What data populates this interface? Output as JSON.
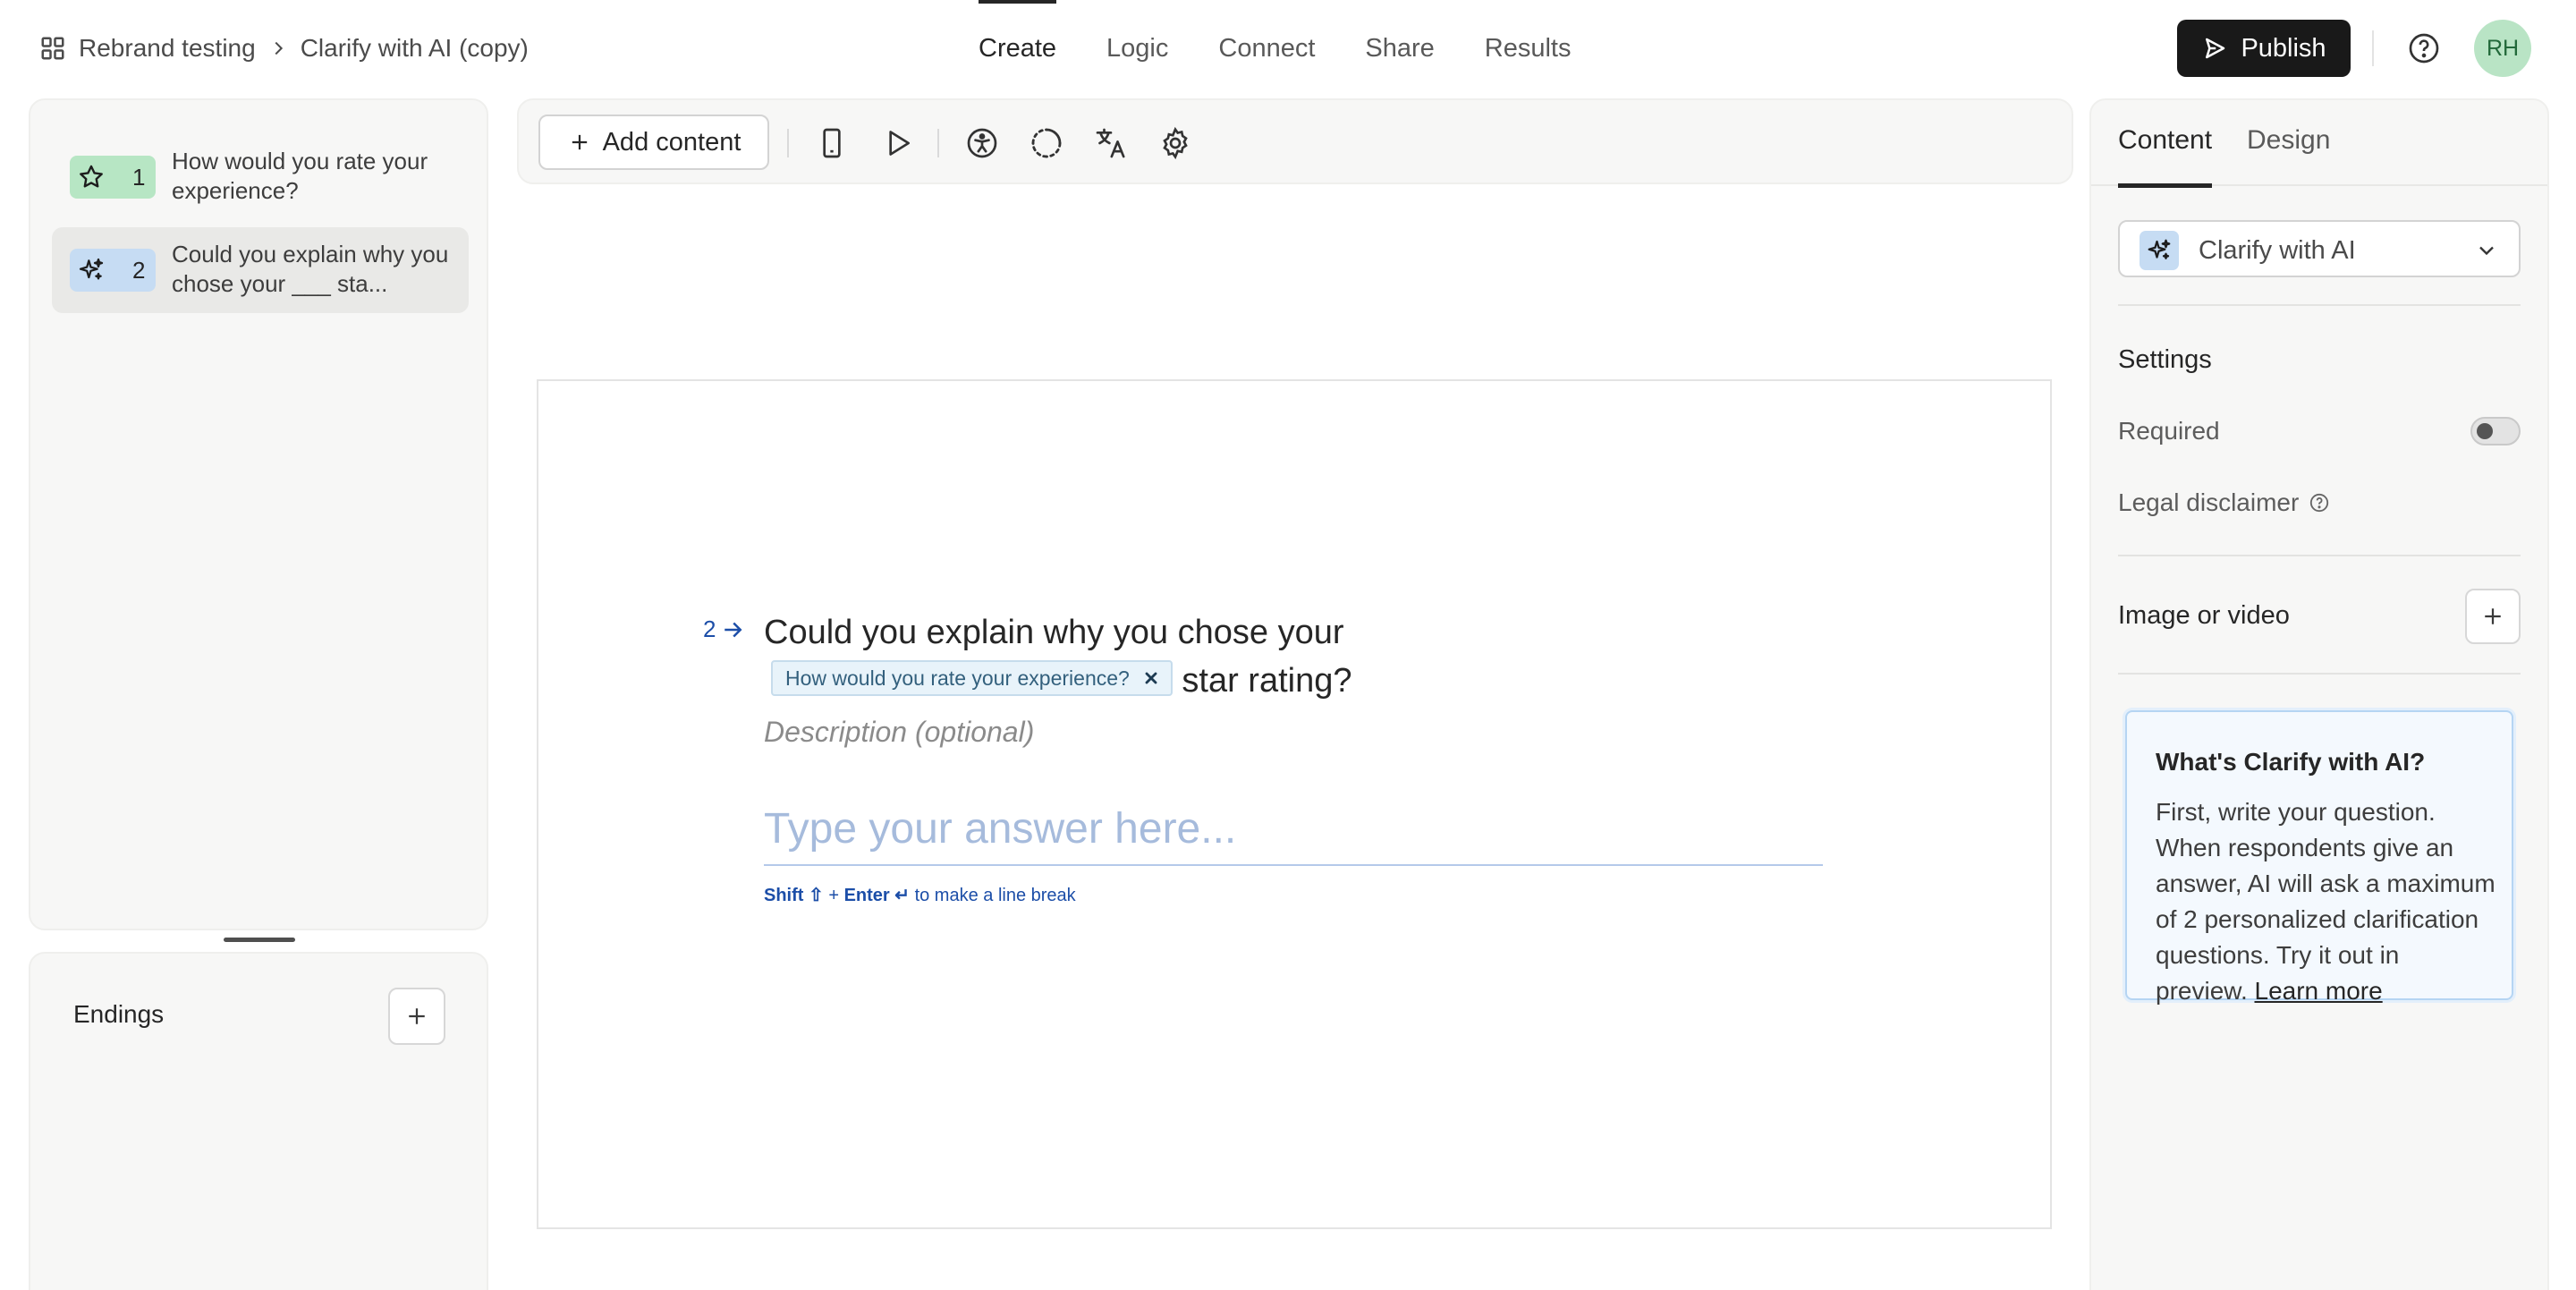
{
  "header": {
    "breadcrumb_workspace": "Rebrand testing",
    "breadcrumb_form": "Clarify with AI (copy)",
    "nav_tabs": [
      {
        "label": "Create",
        "active": true
      },
      {
        "label": "Logic",
        "active": false
      },
      {
        "label": "Connect",
        "active": false
      },
      {
        "label": "Share",
        "active": false
      },
      {
        "label": "Results",
        "active": false
      }
    ],
    "publish_label": "Publish",
    "avatar_initials": "RH"
  },
  "questions": [
    {
      "number": "1",
      "label": "How would you rate your experience?",
      "icon": "star-icon",
      "color": "#b7e6c4",
      "selected": false
    },
    {
      "number": "2",
      "label": "Could you explain why you chose your ___ sta...",
      "icon": "sparkle-icon",
      "color": "#c6dcf3",
      "selected": true
    }
  ],
  "endings": {
    "title": "Endings"
  },
  "toolbar": {
    "add_content_label": "Add content",
    "icons": [
      "mobile-preview-icon",
      "play-icon",
      "accessibility-icon",
      "loading-spinner-icon",
      "translate-icon",
      "settings-gear-icon"
    ]
  },
  "canvas": {
    "question_number": "2",
    "question_text": "Could you explain why you chose your",
    "recall_chip": "How would you rate your experience?",
    "question_text_end": "star rating?",
    "description_placeholder": "Description (optional)",
    "answer_placeholder": "Type your answer here...",
    "hint_shift": "Shift ⇧",
    "hint_plus": "+",
    "hint_enter": "Enter ↵",
    "hint_text": "to make a line break"
  },
  "right_panel": {
    "tabs": [
      {
        "label": "Content",
        "active": true
      },
      {
        "label": "Design",
        "active": false
      }
    ],
    "question_type": "Clarify with AI",
    "settings_heading": "Settings",
    "required_label": "Required",
    "required_value": false,
    "legal_label": "Legal disclaimer",
    "media_label": "Image or video",
    "info_title": "What's Clarify with AI?",
    "info_body": "First, write your question. When respondents give an answer, AI will ask a maximum of 2 personalized clarification questions. Try it out in preview.",
    "info_link": "Learn more"
  },
  "colors": {
    "accent_blue": "#1c4ea8",
    "publish_bg": "#191919",
    "avatar_bg": "#b9e4c5"
  }
}
